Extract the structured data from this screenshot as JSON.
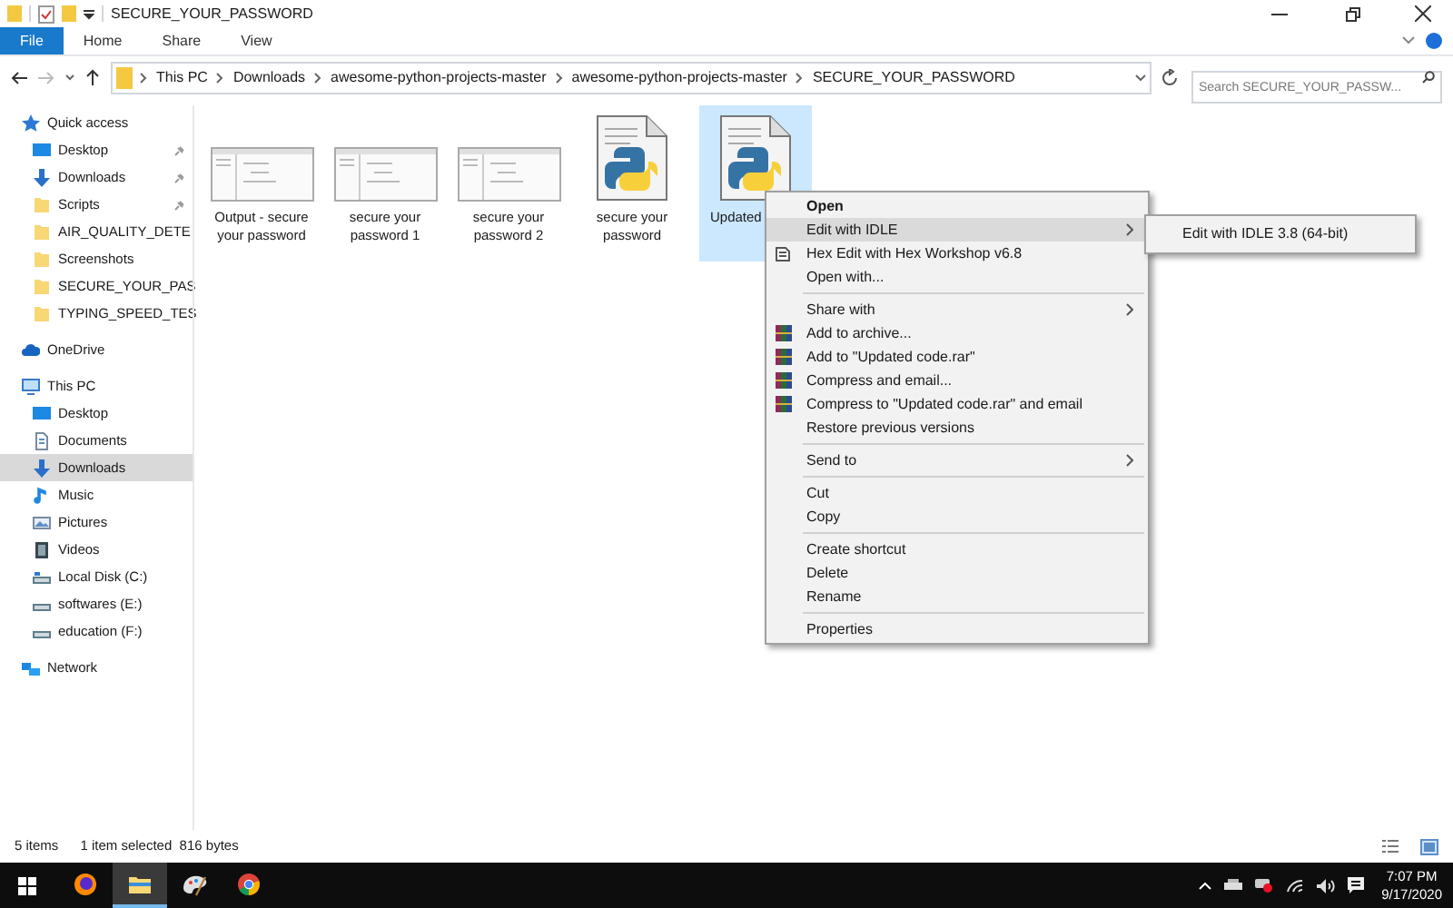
{
  "window": {
    "title": "SECURE_YOUR_PASSWORD"
  },
  "ribbon_tabs": [
    {
      "label": "File",
      "selected": true
    },
    {
      "label": "Home",
      "selected": false
    },
    {
      "label": "Share",
      "selected": false
    },
    {
      "label": "View",
      "selected": false
    }
  ],
  "address_bar": {
    "crumbs": [
      "This PC",
      "Downloads",
      "awesome-python-projects-master",
      "awesome-python-projects-master",
      "SECURE_YOUR_PASSWORD"
    ]
  },
  "search": {
    "placeholder": "Search SECURE_YOUR_PASSW..."
  },
  "sidebar": {
    "items": [
      {
        "label": "Quick access",
        "kind": "star",
        "selected": false,
        "children": [
          {
            "label": "Desktop",
            "kind": "desktop",
            "pinned": true,
            "selected": false
          },
          {
            "label": "Downloads",
            "kind": "download",
            "pinned": true,
            "selected": false
          },
          {
            "label": "Scripts",
            "kind": "folder",
            "pinned": true,
            "selected": false
          },
          {
            "label": "AIR_QUALITY_DETE",
            "kind": "folder",
            "pinned": false,
            "selected": false
          },
          {
            "label": "Screenshots",
            "kind": "folder",
            "pinned": false,
            "selected": false
          },
          {
            "label": "SECURE_YOUR_PAS",
            "kind": "folder",
            "pinned": false,
            "selected": false
          },
          {
            "label": "TYPING_SPEED_TES",
            "kind": "folder",
            "pinned": false,
            "selected": false
          }
        ]
      },
      {
        "label": "OneDrive",
        "kind": "cloud",
        "selected": false
      },
      {
        "label": "This PC",
        "kind": "pc",
        "selected": false,
        "children": [
          {
            "label": "Desktop",
            "kind": "desktop",
            "selected": false
          },
          {
            "label": "Documents",
            "kind": "document",
            "selected": false
          },
          {
            "label": "Downloads",
            "kind": "download",
            "selected": true
          },
          {
            "label": "Music",
            "kind": "music",
            "selected": false
          },
          {
            "label": "Pictures",
            "kind": "pictures",
            "selected": false
          },
          {
            "label": "Videos",
            "kind": "videos",
            "selected": false
          },
          {
            "label": "Local Disk (C:)",
            "kind": "disk",
            "selected": false
          },
          {
            "label": "softwares (E:)",
            "kind": "drive",
            "selected": false
          },
          {
            "label": "education (F:)",
            "kind": "drive",
            "selected": false
          }
        ]
      },
      {
        "label": "Network",
        "kind": "network",
        "selected": false
      }
    ]
  },
  "files": [
    {
      "name": "Output - secure your password",
      "kind": "screenshot",
      "selected": false
    },
    {
      "name": "secure your password 1",
      "kind": "screenshot",
      "selected": false
    },
    {
      "name": "secure your password 2",
      "kind": "screenshot",
      "selected": false
    },
    {
      "name": "secure your password",
      "kind": "python",
      "selected": false
    },
    {
      "name": "Updated",
      "kind": "python",
      "selected": true
    }
  ],
  "context_menu": {
    "items": [
      {
        "kind": "item",
        "label": "Open",
        "bold": true,
        "highlighted": false,
        "submenu": false
      },
      {
        "kind": "item",
        "label": "Edit with IDLE",
        "bold": false,
        "highlighted": true,
        "submenu": true
      },
      {
        "kind": "hex",
        "label": "Hex Edit with Hex Workshop v6.8",
        "bold": false,
        "highlighted": false,
        "submenu": false
      },
      {
        "kind": "item",
        "label": "Open with...",
        "bold": false,
        "highlighted": false,
        "submenu": false
      },
      {
        "kind": "separator"
      },
      {
        "kind": "item",
        "label": "Share with",
        "bold": false,
        "highlighted": false,
        "submenu": true
      },
      {
        "kind": "archive",
        "label": "Add to archive...",
        "bold": false,
        "highlighted": false,
        "submenu": false
      },
      {
        "kind": "archive",
        "label": "Add to \"Updated code.rar\"",
        "bold": false,
        "highlighted": false,
        "submenu": false
      },
      {
        "kind": "archive",
        "label": "Compress and email...",
        "bold": false,
        "highlighted": false,
        "submenu": false
      },
      {
        "kind": "archive",
        "label": "Compress to \"Updated code.rar\" and email",
        "bold": false,
        "highlighted": false,
        "submenu": false
      },
      {
        "kind": "item",
        "label": "Restore previous versions",
        "bold": false,
        "highlighted": false,
        "submenu": false
      },
      {
        "kind": "separator"
      },
      {
        "kind": "item",
        "label": "Send to",
        "bold": false,
        "highlighted": false,
        "submenu": true
      },
      {
        "kind": "separator"
      },
      {
        "kind": "item",
        "label": "Cut",
        "bold": false,
        "highlighted": false,
        "submenu": false
      },
      {
        "kind": "item",
        "label": "Copy",
        "bold": false,
        "highlighted": false,
        "submenu": false
      },
      {
        "kind": "separator"
      },
      {
        "kind": "item",
        "label": "Create shortcut",
        "bold": false,
        "highlighted": false,
        "submenu": false
      },
      {
        "kind": "item",
        "label": "Delete",
        "bold": false,
        "highlighted": false,
        "submenu": false
      },
      {
        "kind": "item",
        "label": "Rename",
        "bold": false,
        "highlighted": false,
        "submenu": false
      },
      {
        "kind": "separator"
      },
      {
        "kind": "item",
        "label": "Properties",
        "bold": false,
        "highlighted": false,
        "submenu": false
      }
    ]
  },
  "submenu": {
    "items": [
      "Edit with IDLE 3.8 (64-bit)"
    ]
  },
  "status_bar": {
    "item_count": "5 items",
    "selection": "1 item selected  816 bytes"
  },
  "taskbar": {
    "apps": [
      {
        "kind": "firefox",
        "active": false
      },
      {
        "kind": "explorer",
        "active": true
      },
      {
        "kind": "paint",
        "active": false
      },
      {
        "kind": "chrome",
        "active": false
      }
    ],
    "time": "7:07 PM",
    "date": "9/17/2020"
  }
}
